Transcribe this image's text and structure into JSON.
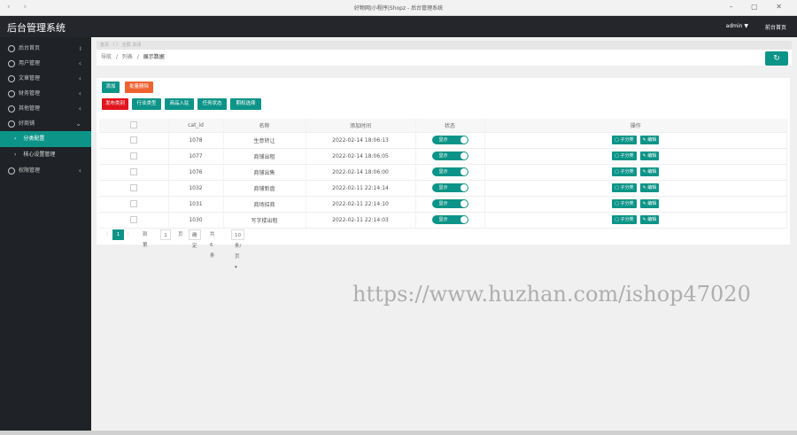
{
  "browser": {
    "nav": "‹ ›",
    "title": "好物网|小程序|Shopz - 后台管理系统",
    "window_controls": "– ▢ ✕"
  },
  "header": {
    "app_title": "后台管理系统",
    "user": "admin ▼",
    "home": "前台首页"
  },
  "sidebar": {
    "items": [
      {
        "label": "后台首页",
        "icon": "home-icon"
      },
      {
        "label": "用户管理",
        "icon": "user-icon"
      },
      {
        "label": "文章管理",
        "icon": "article-icon"
      },
      {
        "label": "财务管理",
        "icon": "finance-icon"
      },
      {
        "label": "其他管理",
        "icon": "settings-icon"
      },
      {
        "label": "好商铺",
        "icon": "shop-icon"
      },
      {
        "label": "分类配置",
        "icon": "category-icon"
      },
      {
        "label": "核心设置管理",
        "icon": "core-icon"
      },
      {
        "label": "权限管理",
        "icon": "permission-icon"
      }
    ]
  },
  "tabs_strip": "首页 〈 〉 全屏 关闭",
  "breadcrumb": {
    "home": "导航",
    "sep1": "/",
    "level1": "列表",
    "sep2": "/",
    "current": "展示数据"
  },
  "toolbar": {
    "add": "添加",
    "batch_delete": "批量删除",
    "filters": [
      "发布类别",
      "行业类型",
      "商品入驻",
      "任务状态",
      "期权选择"
    ]
  },
  "table": {
    "headers": [
      "cat_id",
      "名称",
      "添加时间",
      "状态",
      "操作"
    ],
    "rows": [
      {
        "id": "1078",
        "name": "生意转让",
        "time": "2022-02-14 18:06:13",
        "status": "显示"
      },
      {
        "id": "1077",
        "name": "商铺出租",
        "time": "2022-02-14 18:06:05",
        "status": "显示"
      },
      {
        "id": "1076",
        "name": "商铺出售",
        "time": "2022-02-14 18:06:00",
        "status": "显示"
      },
      {
        "id": "1032",
        "name": "商铺新盘",
        "time": "2022-02-11 22:14:14",
        "status": "显示"
      },
      {
        "id": "1031",
        "name": "商场招商",
        "time": "2022-02-11 22:14:10",
        "status": "显示"
      },
      {
        "id": "1030",
        "name": "写字楼出租",
        "time": "2022-02-11 22:14:03",
        "status": "显示"
      }
    ],
    "op_sub": "子分类",
    "op_edit": "编辑"
  },
  "pager": {
    "prev": "〈",
    "current": "1",
    "next": "〉",
    "goto_label": "到第",
    "goto_value": "1",
    "page_unit": "页",
    "go": "确定",
    "total": "共 6 条",
    "size": "10 条/页 ▾"
  },
  "watermark": "https://www.huzhan.com/ishop47020",
  "colors": {
    "accent": "#0d9488",
    "orange": "#ee6230",
    "red": "#e2141c"
  }
}
